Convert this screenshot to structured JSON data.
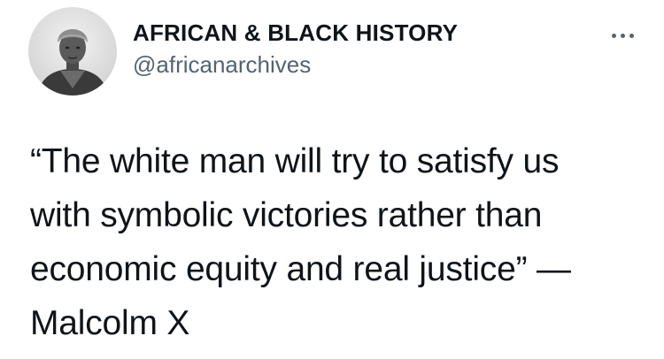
{
  "tweet": {
    "author": {
      "display_name": "AFRICAN & BLACK HISTORY",
      "handle": "@africanarchives",
      "avatar_icon": "profile-photo"
    },
    "more_icon": "more-options-icon",
    "text": "“The white man will try to satisfy us\nwith symbolic victories rather than\neconomic equity and real justice” —\nMalcolm X"
  },
  "colors": {
    "text_primary": "#0f1419",
    "text_secondary": "#536471",
    "background": "#ffffff"
  }
}
